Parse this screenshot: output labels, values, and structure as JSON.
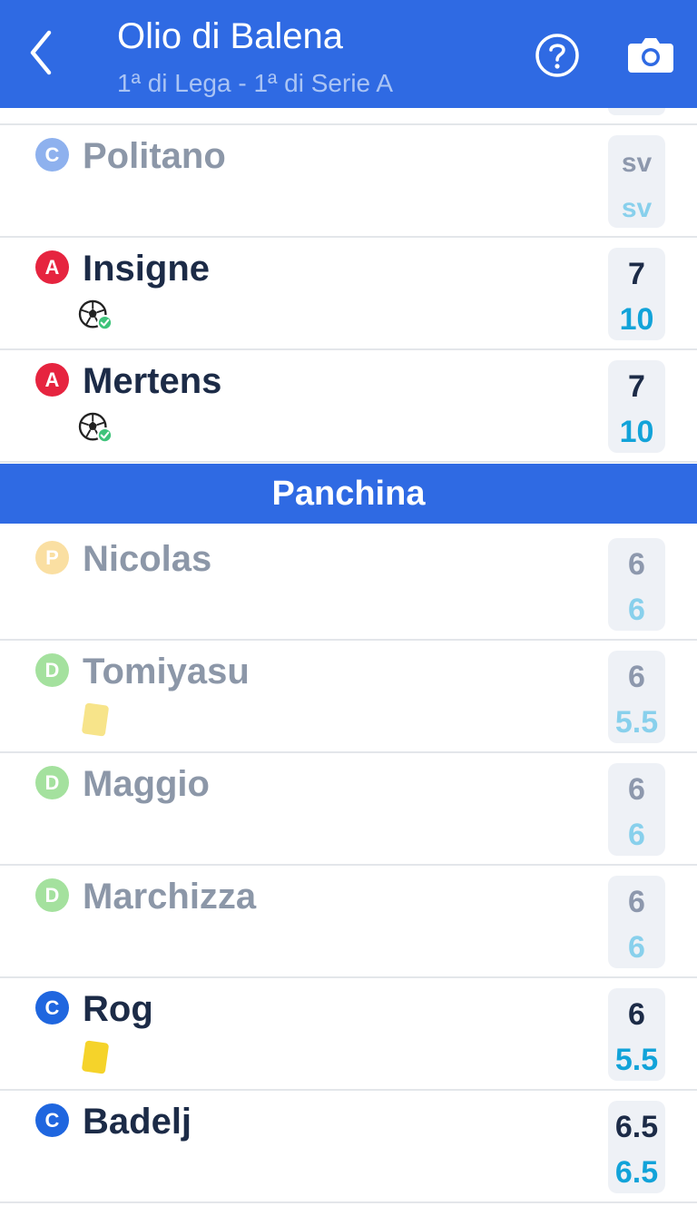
{
  "header": {
    "title": "Olio di Balena",
    "subtitle": "1ª di Lega - 1ª di Serie A",
    "back_icon": "chevron-left-icon",
    "help_icon": "question-circle-icon",
    "camera_icon": "camera-icon"
  },
  "colors": {
    "header_bg": "#2f6ae3",
    "role_C": "#1f66df",
    "role_A": "#e6243f",
    "role_P": "#f6c048",
    "role_D": "#4cc43f",
    "score_primary": "#1c2b47",
    "score_fanta": "#12a3d9"
  },
  "starters": [
    {
      "role": "C",
      "name": "Politano",
      "vote": "sv",
      "fantavote": "sv",
      "active": false,
      "events": []
    },
    {
      "role": "A",
      "name": "Insigne",
      "vote": "7",
      "fantavote": "10",
      "active": true,
      "events": [
        "goal"
      ]
    },
    {
      "role": "A",
      "name": "Mertens",
      "vote": "7",
      "fantavote": "10",
      "active": true,
      "events": [
        "goal"
      ]
    }
  ],
  "bench_label": "Panchina",
  "bench": [
    {
      "role": "P",
      "name": "Nicolas",
      "vote": "6",
      "fantavote": "6",
      "active": false,
      "events": []
    },
    {
      "role": "D",
      "name": "Tomiyasu",
      "vote": "6",
      "fantavote": "5.5",
      "active": false,
      "events": [
        "yellow-card"
      ]
    },
    {
      "role": "D",
      "name": "Maggio",
      "vote": "6",
      "fantavote": "6",
      "active": false,
      "events": []
    },
    {
      "role": "D",
      "name": "Marchizza",
      "vote": "6",
      "fantavote": "6",
      "active": false,
      "events": []
    },
    {
      "role": "C",
      "name": "Rog",
      "vote": "6",
      "fantavote": "5.5",
      "active": true,
      "events": [
        "yellow-card"
      ]
    },
    {
      "role": "C",
      "name": "Badelj",
      "vote": "6.5",
      "fantavote": "6.5",
      "active": true,
      "events": []
    }
  ]
}
